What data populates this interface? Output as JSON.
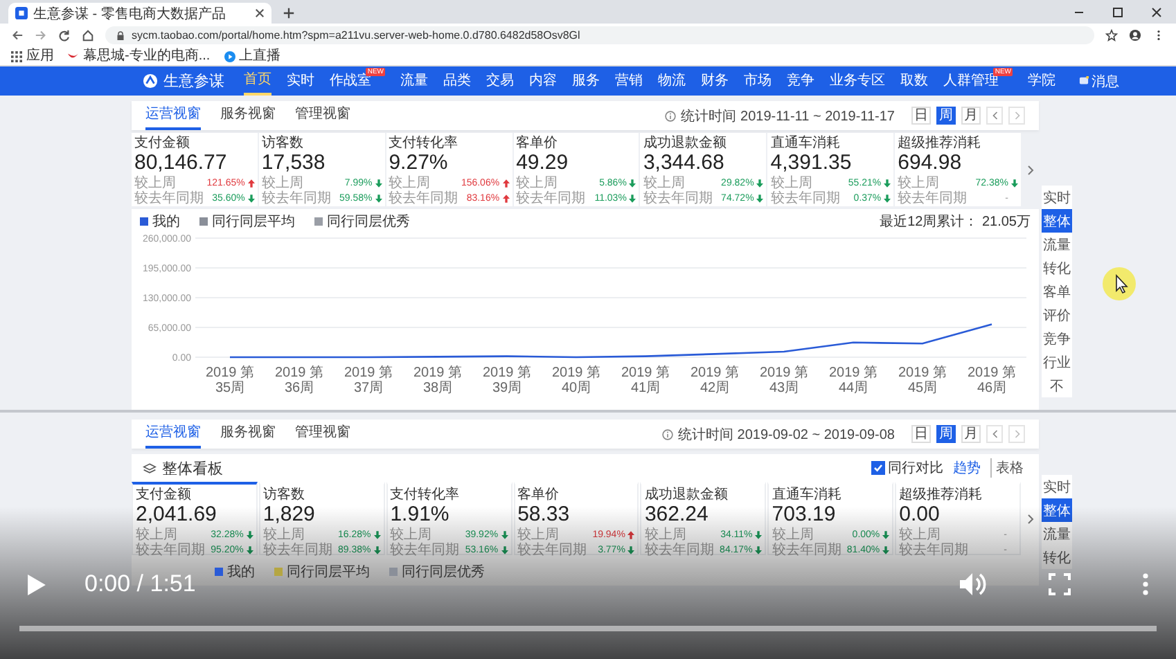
{
  "browser": {
    "tab_title": "生意参谋 - 零售电商大数据产品",
    "url": "sycm.taobao.com/portal/home.htm?spm=a211vu.server-web-home.0.d780.6482d58Osv8Gl",
    "bookmarks": [
      {
        "label": "应用",
        "kind": "apps"
      },
      {
        "label": "幕思城-专业的电商...",
        "kind": "brand"
      },
      {
        "label": "上直播",
        "kind": "live"
      }
    ]
  },
  "nav": {
    "logo": "生意参谋",
    "items": [
      {
        "label": "首页",
        "selected": true
      },
      {
        "label": "实时",
        "selected": false
      },
      {
        "label": "作战室",
        "selected": false,
        "badge": "NEW"
      },
      {
        "label": "流量",
        "selected": false
      },
      {
        "label": "品类",
        "selected": false
      },
      {
        "label": "交易",
        "selected": false
      },
      {
        "label": "内容",
        "selected": false
      },
      {
        "label": "服务",
        "selected": false
      },
      {
        "label": "营销",
        "selected": false
      },
      {
        "label": "物流",
        "selected": false
      },
      {
        "label": "财务",
        "selected": false
      },
      {
        "label": "市场",
        "selected": false
      },
      {
        "label": "竞争",
        "selected": false
      },
      {
        "label": "业务专区",
        "selected": false
      },
      {
        "label": "取数",
        "selected": false
      },
      {
        "label": "人群管理",
        "selected": false,
        "badge": "NEW"
      },
      {
        "label": "学院",
        "selected": false
      }
    ],
    "message": "消息"
  },
  "panels": [
    {
      "subtabs": [
        {
          "label": "运营视窗",
          "selected": true
        },
        {
          "label": "服务视窗",
          "selected": false
        },
        {
          "label": "管理视窗",
          "selected": false
        }
      ],
      "date_range": "统计时间 2019-11-11 ~ 2019-11-17",
      "periods": [
        {
          "label": "日",
          "selected": false
        },
        {
          "label": "周",
          "selected": true
        },
        {
          "label": "月",
          "selected": false
        }
      ],
      "metrics": [
        {
          "label": "支付金额",
          "value": "80,146.77",
          "rows": [
            {
              "label": "较上周",
              "change": "121.65%",
              "kind": "up"
            },
            {
              "label": "较去年同期",
              "change": "35.60%",
              "kind": "down"
            }
          ]
        },
        {
          "label": "访客数",
          "value": "17,538",
          "rows": [
            {
              "label": "较上周",
              "change": "7.99%",
              "kind": "down"
            },
            {
              "label": "较去年同期",
              "change": "59.58%",
              "kind": "down"
            }
          ]
        },
        {
          "label": "支付转化率",
          "value": "9.27%",
          "rows": [
            {
              "label": "较上周",
              "change": "156.06%",
              "kind": "up"
            },
            {
              "label": "较去年同期",
              "change": "83.16%",
              "kind": "up"
            }
          ]
        },
        {
          "label": "客单价",
          "value": "49.29",
          "rows": [
            {
              "label": "较上周",
              "change": "5.86%",
              "kind": "down"
            },
            {
              "label": "较去年同期",
              "change": "11.03%",
              "kind": "down"
            }
          ]
        },
        {
          "label": "成功退款金额",
          "value": "3,344.68",
          "rows": [
            {
              "label": "较上周",
              "change": "29.82%",
              "kind": "down"
            },
            {
              "label": "较去年同期",
              "change": "74.72%",
              "kind": "down"
            }
          ]
        },
        {
          "label": "直通车消耗",
          "value": "4,391.35",
          "rows": [
            {
              "label": "较上周",
              "change": "55.21%",
              "kind": "down"
            },
            {
              "label": "较去年同期",
              "change": "0.37%",
              "kind": "down"
            }
          ]
        },
        {
          "label": "超级推荐消耗",
          "value": "694.98",
          "rows": [
            {
              "label": "较上周",
              "change": "72.38%",
              "kind": "down"
            },
            {
              "label": "较去年同期",
              "change": "-",
              "kind": "none"
            }
          ]
        }
      ],
      "chart": {
        "total": "最近12周累计： 21.05万",
        "chart_data": {
          "type": "line",
          "categories": [
            "2019 第35周",
            "2019 第36周",
            "2019 第37周",
            "2019 第38周",
            "2019 第39周",
            "2019 第40周",
            "2019 第41周",
            "2019 第42周",
            "2019 第43周",
            "2019 第44周",
            "2019 第45周",
            "2019 第46周"
          ],
          "series": [
            {
              "name": "我的",
              "color": "#2a5bd7",
              "values": [
                0,
                0,
                0,
                1000,
                2000,
                0,
                2000,
                7000,
                12000,
                32000,
                30000,
                72000
              ]
            },
            {
              "name": "同行同层平均",
              "color": "#8a8f99",
              "values": [
                null,
                null,
                null,
                null,
                null,
                null,
                null,
                null,
                null,
                null,
                null,
                null
              ]
            },
            {
              "name": "同行同层优秀",
              "color": "#9a9ea6",
              "values": [
                null,
                null,
                null,
                null,
                null,
                null,
                null,
                null,
                null,
                null,
                null,
                null
              ]
            }
          ],
          "ylim": [
            0,
            260000
          ],
          "grid": true,
          "yticks": [
            {
              "value": 0,
              "label": "0.00"
            },
            {
              "value": 65000,
              "label": "65,000.00"
            },
            {
              "value": 130000,
              "label": "130,000.00"
            },
            {
              "value": 195000,
              "label": "195,000.00"
            },
            {
              "value": 260000,
              "label": "260,000.00"
            }
          ]
        }
      },
      "rail": [
        {
          "label": "实时",
          "selected": false
        },
        {
          "label": "整体",
          "selected": true
        },
        {
          "label": "流量",
          "selected": false
        },
        {
          "label": "转化",
          "selected": false
        },
        {
          "label": "客单",
          "selected": false
        },
        {
          "label": "评价",
          "selected": false
        },
        {
          "label": "竞争",
          "selected": false
        },
        {
          "label": "行业",
          "selected": false
        },
        {
          "label": "不",
          "selected": false
        }
      ]
    },
    {
      "subtabs": [
        {
          "label": "运营视窗",
          "selected": true
        },
        {
          "label": "服务视窗",
          "selected": false
        },
        {
          "label": "管理视窗",
          "selected": false
        }
      ],
      "date_range": "统计时间 2019-09-02 ~ 2019-09-08",
      "periods": [
        {
          "label": "日",
          "selected": false
        },
        {
          "label": "周",
          "selected": true
        },
        {
          "label": "月",
          "selected": false
        }
      ],
      "board": {
        "title": "整体看板",
        "compare": {
          "label": "同行对比",
          "checked": true
        },
        "views": [
          {
            "label": "趋势",
            "selected": true
          },
          {
            "label": "表格",
            "selected": false
          }
        ]
      },
      "metrics": [
        {
          "label": "支付金额",
          "value": "2,041.69",
          "selected": true,
          "rows": [
            {
              "label": "较上周",
              "change": "32.28%",
              "kind": "down"
            },
            {
              "label": "较去年同期",
              "change": "95.20%",
              "kind": "down"
            }
          ]
        },
        {
          "label": "访客数",
          "value": "1,829",
          "selected": false,
          "rows": [
            {
              "label": "较上周",
              "change": "16.28%",
              "kind": "down"
            },
            {
              "label": "较去年同期",
              "change": "89.38%",
              "kind": "down"
            }
          ]
        },
        {
          "label": "支付转化率",
          "value": "1.91%",
          "selected": false,
          "rows": [
            {
              "label": "较上周",
              "change": "39.92%",
              "kind": "down"
            },
            {
              "label": "较去年同期",
              "change": "53.16%",
              "kind": "down"
            }
          ]
        },
        {
          "label": "客单价",
          "value": "58.33",
          "selected": false,
          "rows": [
            {
              "label": "较上周",
              "change": "19.94%",
              "kind": "up"
            },
            {
              "label": "较去年同期",
              "change": "3.77%",
              "kind": "down"
            }
          ]
        },
        {
          "label": "成功退款金额",
          "value": "362.24",
          "selected": false,
          "rows": [
            {
              "label": "较上周",
              "change": "34.11%",
              "kind": "down"
            },
            {
              "label": "较去年同期",
              "change": "84.17%",
              "kind": "down"
            }
          ]
        },
        {
          "label": "直通车消耗",
          "value": "703.19",
          "selected": false,
          "rows": [
            {
              "label": "较上周",
              "change": "0.00%",
              "kind": "down"
            },
            {
              "label": "较去年同期",
              "change": "81.40%",
              "kind": "down"
            }
          ]
        },
        {
          "label": "超级推荐消耗",
          "value": "0.00",
          "selected": false,
          "rows": [
            {
              "label": "较上周",
              "change": "-",
              "kind": "none"
            },
            {
              "label": "较去年同期",
              "change": "-",
              "kind": "none"
            }
          ]
        }
      ],
      "legend": [
        {
          "name": "我的",
          "color": "#2a5bd7"
        },
        {
          "name": "同行同层平均",
          "color": "#b5a642"
        },
        {
          "name": "同行同层优秀",
          "color": "#8a8f99"
        }
      ],
      "rail": [
        {
          "label": "实时",
          "selected": false
        },
        {
          "label": "整体",
          "selected": true
        },
        {
          "label": "流量",
          "selected": false
        },
        {
          "label": "转化",
          "selected": false
        }
      ]
    }
  ],
  "video": {
    "time": "0:00 / 1:51",
    "level": 0
  }
}
